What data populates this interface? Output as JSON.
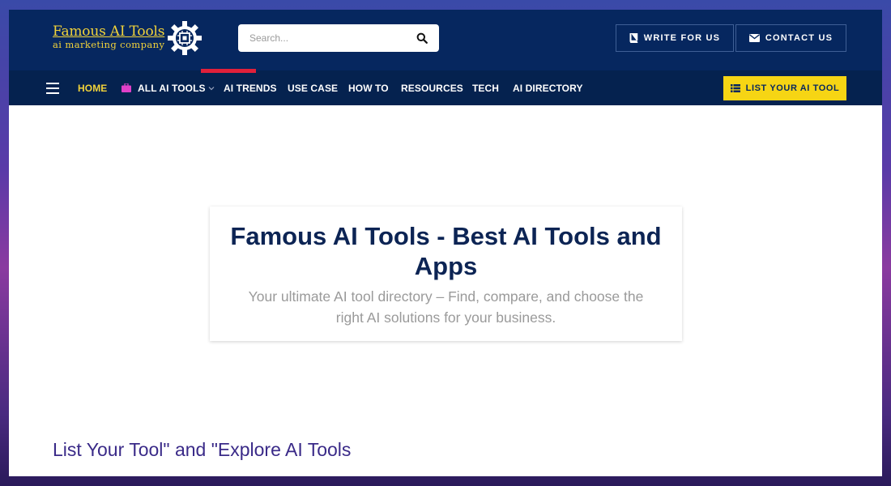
{
  "header": {
    "logo_title": "Famous AI Tools",
    "logo_subtitle": "ai marketing company",
    "search_placeholder": "Search...",
    "write_for_us": "WRITE FOR US",
    "contact_us": "CONTACT US"
  },
  "nav": {
    "items": [
      {
        "label": "HOME",
        "active": true
      },
      {
        "label": "ALL AI TOOLS",
        "icon": "briefcase-icon",
        "dropdown": true
      },
      {
        "label": "AI TRENDS"
      },
      {
        "label": "USE CASE"
      },
      {
        "label": "HOW TO"
      },
      {
        "label": "RESOURCES"
      },
      {
        "label": "TECH"
      },
      {
        "label": "AI DIRECTORY"
      }
    ],
    "cta_label": "LIST YOUR AI TOOL"
  },
  "hero": {
    "title": "Famous AI Tools - Best AI Tools and Apps",
    "subtitle": "Your ultimate AI tool directory – Find, compare, and choose the right AI solutions for your business."
  },
  "section": {
    "heading": "List Your Tool\" and \"Explore AI Tools"
  },
  "colors": {
    "header_bg": "#06275f",
    "nav_bg": "#05224f",
    "accent_yellow": "#f6d514",
    "active_nav": "#f2d33a",
    "hero_title": "#0c2454",
    "section_heading": "#3a2a88"
  }
}
